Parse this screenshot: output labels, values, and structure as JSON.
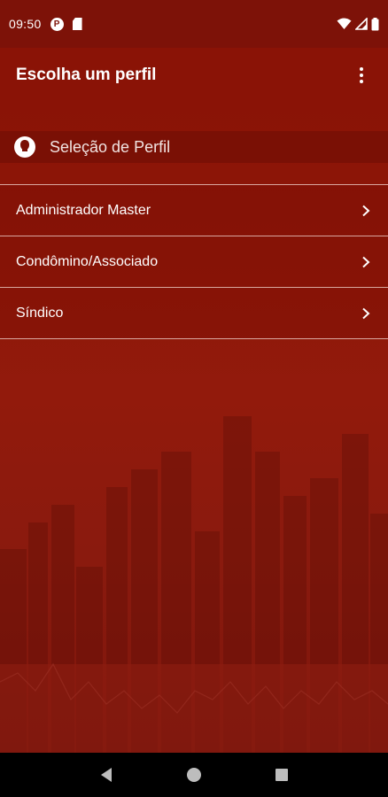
{
  "status_bar": {
    "time": "09:50",
    "left_icons": [
      "notification-circle-icon",
      "sd-card-icon"
    ],
    "right_icons": [
      "wifi-icon",
      "signal-icon",
      "battery-icon"
    ]
  },
  "app_bar": {
    "title": "Escolha um perfil",
    "menu_icon": "more-vert-icon"
  },
  "section": {
    "icon": "profile-icon",
    "title": "Seleção de Perfil"
  },
  "profiles": [
    {
      "label": "Administrador Master"
    },
    {
      "label": "Condômino/Associado"
    },
    {
      "label": "Síndico"
    }
  ],
  "nav_bar": {
    "buttons": [
      "back-icon",
      "home-icon",
      "recents-icon"
    ]
  },
  "colors": {
    "status_bar": "#7d1208",
    "app_bar": "#8a1306",
    "background": "#8f1809",
    "section_header": "#7a1005",
    "divider": "#d9a79f"
  }
}
